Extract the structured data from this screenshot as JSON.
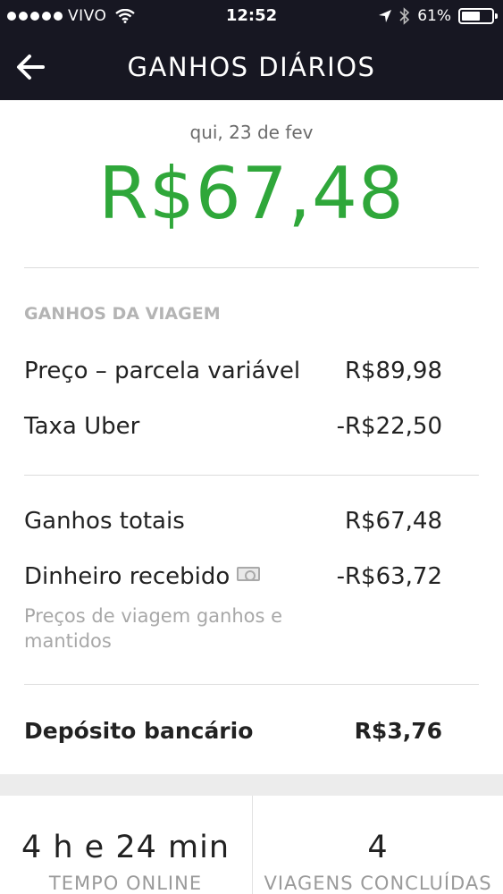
{
  "status_bar": {
    "carrier": "VIVO",
    "time": "12:52",
    "battery": "61%",
    "battery_level": 0.61,
    "icons": [
      "signal-dots-icon",
      "wifi-icon",
      "location-arrow-icon",
      "bluetooth-icon",
      "battery-icon"
    ]
  },
  "nav": {
    "title": "GANHOS DIÁRIOS",
    "back_icon": "arrow-left-icon"
  },
  "summary": {
    "date": "qui, 23 de fev",
    "total": "R$67,48",
    "total_color": "#2fa73a"
  },
  "trip_earnings": {
    "label": "GANHOS DA VIAGEM",
    "rows": [
      {
        "label": "Preço – parcela variável",
        "value": "R$89,98"
      },
      {
        "label": "Taxa Uber",
        "value": "-R$22,50"
      }
    ]
  },
  "totals": {
    "rows": [
      {
        "label": "Ganhos totais",
        "value": "R$67,48"
      },
      {
        "label": "Dinheiro recebido",
        "value": "-R$63,72",
        "icon": "cash-icon"
      }
    ],
    "note": "Preços de viagem ganhos e mantidos"
  },
  "deposit": {
    "label": "Depósito bancário",
    "value": "R$3,76"
  },
  "stats": [
    {
      "value": "4 h e 24 min",
      "label": "TEMPO ONLINE"
    },
    {
      "value": "4",
      "label": "VIAGENS CONCLUÍDAS"
    }
  ]
}
